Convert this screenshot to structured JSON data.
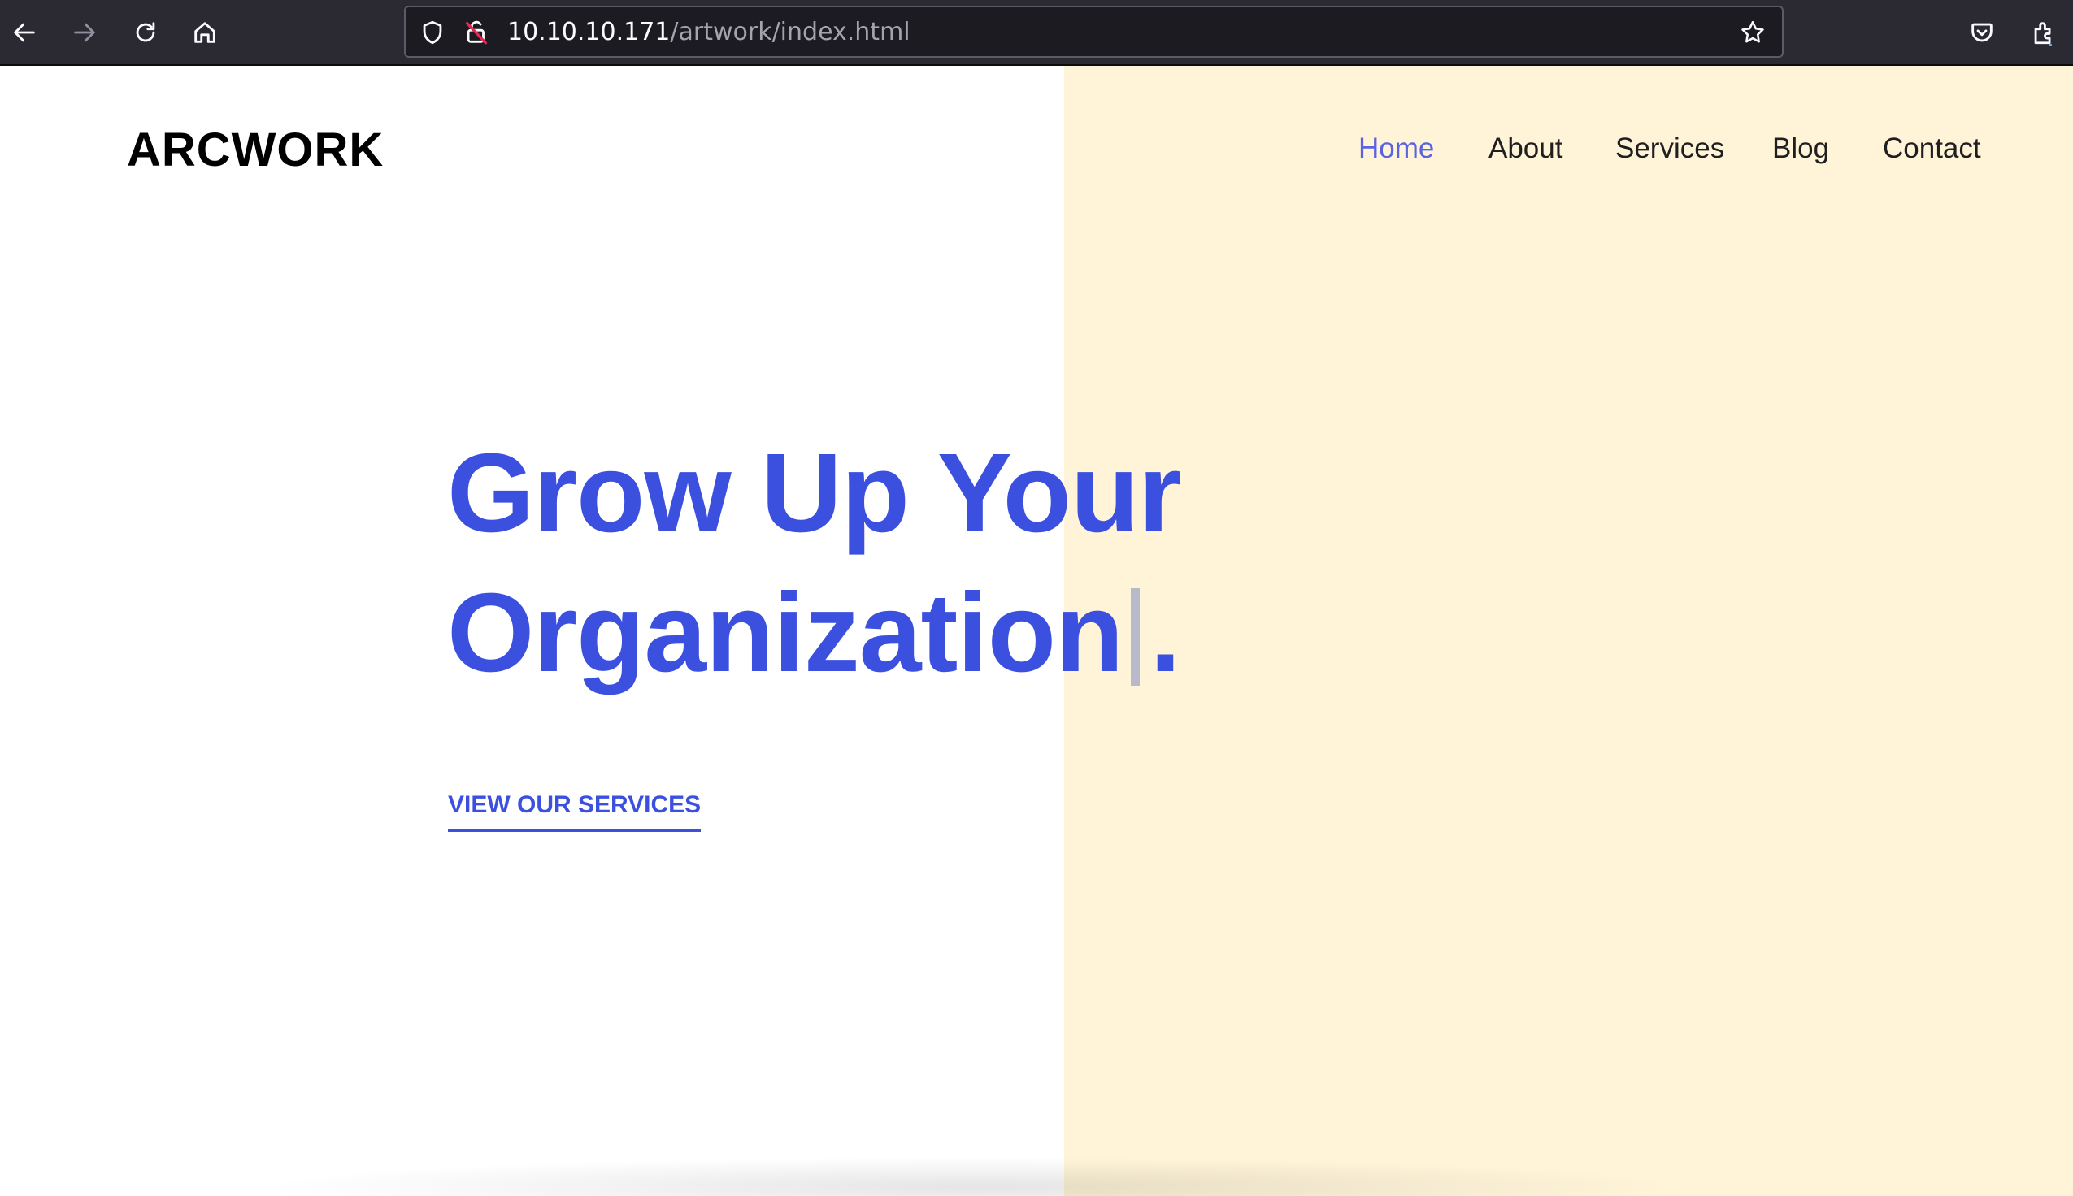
{
  "browser": {
    "url_host": "10.10.10.171",
    "url_path": "/artwork/index.html",
    "icons": {
      "back": "arrow-left-icon",
      "forward": "arrow-right-icon",
      "reload": "reload-icon",
      "home": "home-icon",
      "tracking": "shield-icon",
      "security": "insecure-lock-icon",
      "bookmark": "star-icon",
      "pocket": "pocket-icon",
      "extensions": "extensions-icon"
    }
  },
  "site": {
    "logo": "ARCWORK",
    "nav": [
      {
        "label": "Home",
        "active": true
      },
      {
        "label": "About",
        "active": false
      },
      {
        "label": "Services",
        "active": false
      },
      {
        "label": "Blog",
        "active": false
      },
      {
        "label": "Contact",
        "active": false
      }
    ],
    "hero": {
      "line1": "Grow Up Your",
      "line2_word": "Organization",
      "line2_end": ".",
      "cta": "VIEW OUR SERVICES"
    }
  },
  "colors": {
    "accent": "#3c50e0",
    "nav_active": "#5a63e0",
    "hero_panel": "#fff4d8",
    "toolbar": "#2b2a33"
  }
}
